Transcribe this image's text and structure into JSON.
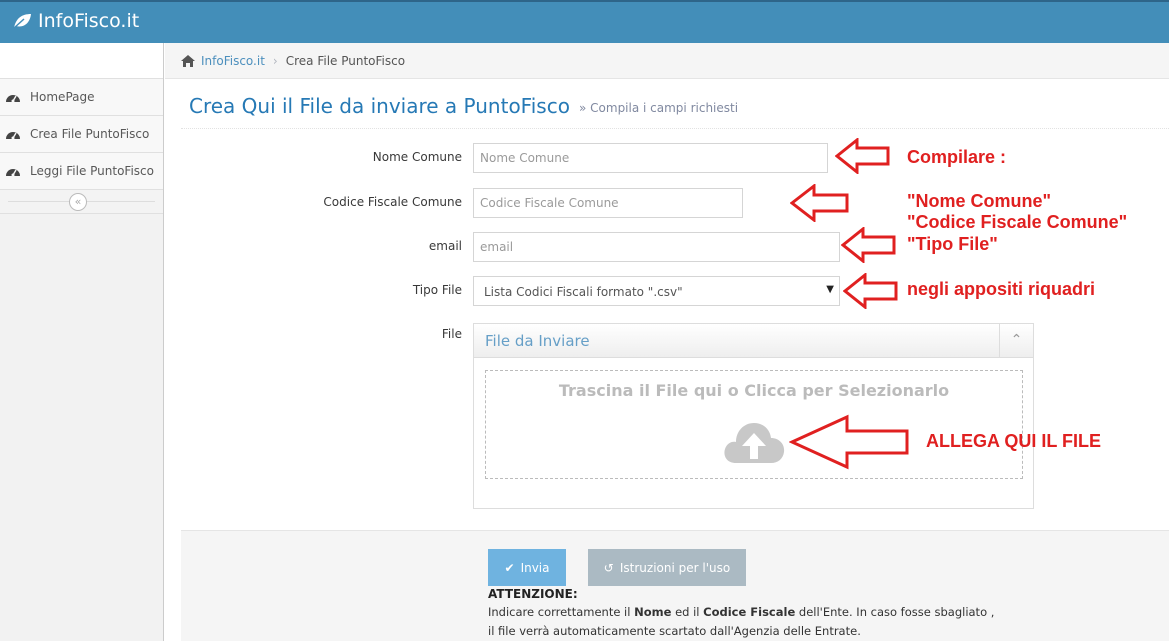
{
  "app": {
    "brand": "InfoFisco.it"
  },
  "sidebar": {
    "items": [
      {
        "label": "HomePage",
        "icon": "dashboard-icon"
      },
      {
        "label": "Crea File PuntoFisco",
        "icon": "dashboard-icon"
      },
      {
        "label": "Leggi File PuntoFisco",
        "icon": "dashboard-icon"
      }
    ],
    "collapse_icon": "double-chevron-left-icon"
  },
  "breadcrumb": {
    "home": "InfoFisco.it",
    "current": "Crea File PuntoFisco"
  },
  "header": {
    "title": "Crea Qui il File da inviare a PuntoFisco",
    "subtitle": "» Compila i campi richiesti"
  },
  "form": {
    "nome_comune": {
      "label": "Nome Comune",
      "placeholder": "Nome Comune"
    },
    "codice_fiscale": {
      "label": "Codice Fiscale Comune",
      "placeholder": "Codice Fiscale Comune"
    },
    "email": {
      "label": "email",
      "placeholder": "email"
    },
    "tipo_file": {
      "label": "Tipo File",
      "selected": "Lista Codici Fiscali formato \".csv\""
    },
    "file": {
      "label": "File",
      "widget_title": "File da Inviare",
      "drop_text": "Trascina il File qui o Clicca per Selezionarlo"
    }
  },
  "actions": {
    "submit": "Invia",
    "instructions": "Istruzioni per l'uso"
  },
  "notice": {
    "title": "ATTENZIONE:",
    "l1_a": "Indicare correttamente il ",
    "l1_b": "Nome",
    "l1_c": " ed il ",
    "l1_d": "Codice Fiscale",
    "l1_e": " dell'Ente. In caso fosse sbagliato ,",
    "l2": "il file verrà automaticamente scartato dall'Agenzia delle Entrate."
  },
  "annotations": {
    "a1": "Compilare :",
    "a2": "\"Nome Comune\"",
    "a3": "\"Codice Fiscale Comune\"",
    "a4": "\"Tipo File\"",
    "a5": "negli appositi riquadri",
    "a6": "ALLEGA QUI  IL FILE"
  },
  "colors": {
    "topbar": "#438eb9",
    "title": "#2679b5",
    "annotation": "#e02020"
  }
}
